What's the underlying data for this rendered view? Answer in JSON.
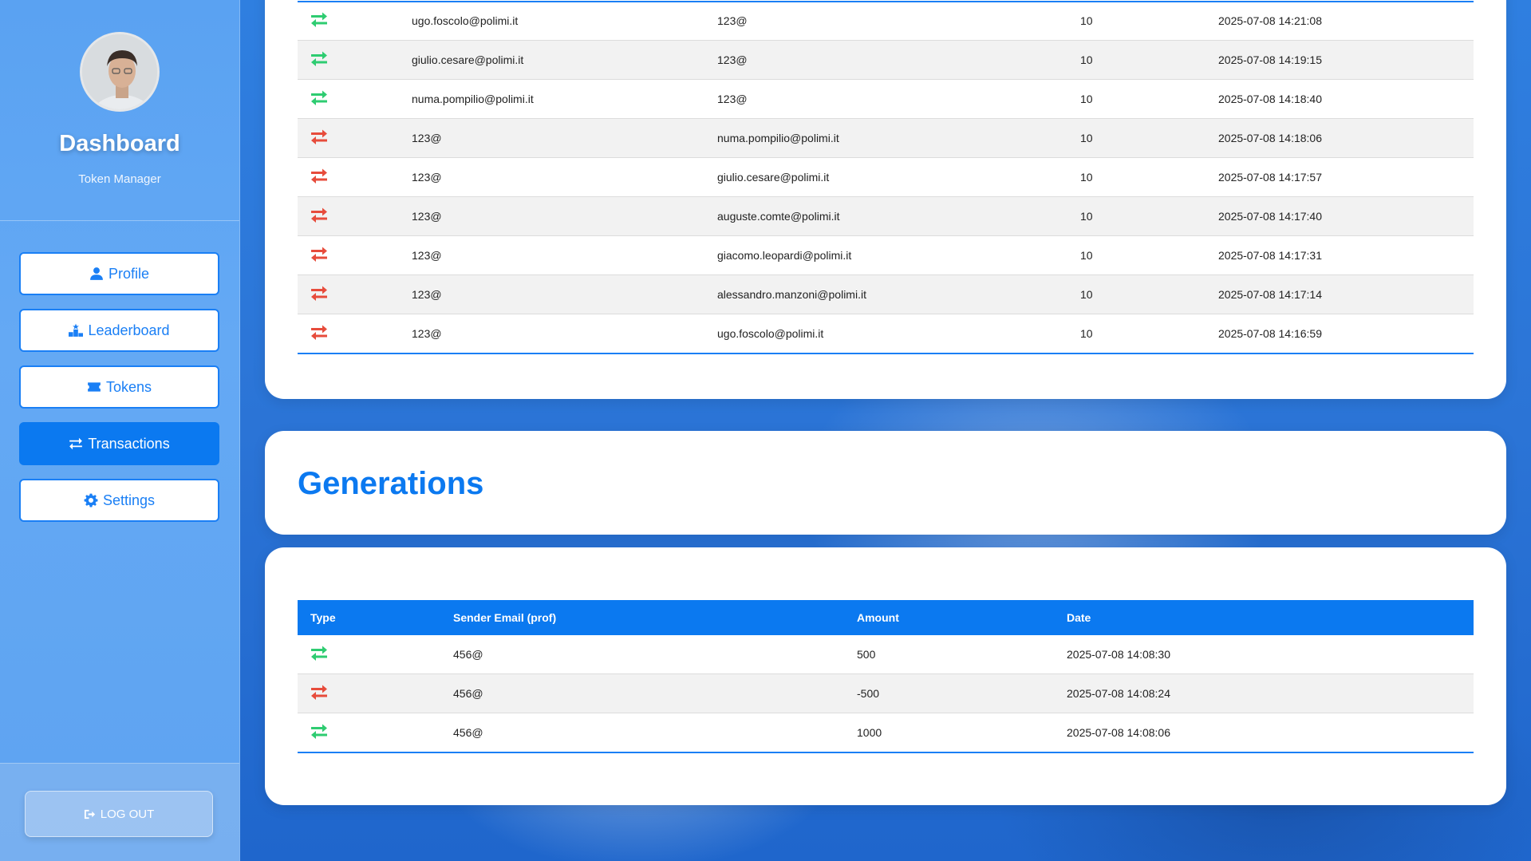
{
  "sidebar": {
    "title": "Dashboard",
    "subtitle": "Token Manager",
    "nav": [
      {
        "label": "Profile",
        "icon": "user-icon"
      },
      {
        "label": "Leaderboard",
        "icon": "podium-icon"
      },
      {
        "label": "Tokens",
        "icon": "ticket-icon"
      },
      {
        "label": "Transactions",
        "icon": "exchange-icon",
        "active": true
      },
      {
        "label": "Settings",
        "icon": "gear-icon"
      }
    ],
    "logout_label": "LOG OUT"
  },
  "transactions": {
    "rows": [
      {
        "type": "in",
        "sender": "ugo.foscolo@polimi.it",
        "receiver": "123@",
        "amount": "10",
        "date": "2025-07-08 14:21:08"
      },
      {
        "type": "in",
        "sender": "giulio.cesare@polimi.it",
        "receiver": "123@",
        "amount": "10",
        "date": "2025-07-08 14:19:15"
      },
      {
        "type": "in",
        "sender": "numa.pompilio@polimi.it",
        "receiver": "123@",
        "amount": "10",
        "date": "2025-07-08 14:18:40"
      },
      {
        "type": "out",
        "sender": "123@",
        "receiver": "numa.pompilio@polimi.it",
        "amount": "10",
        "date": "2025-07-08 14:18:06"
      },
      {
        "type": "out",
        "sender": "123@",
        "receiver": "giulio.cesare@polimi.it",
        "amount": "10",
        "date": "2025-07-08 14:17:57"
      },
      {
        "type": "out",
        "sender": "123@",
        "receiver": "auguste.comte@polimi.it",
        "amount": "10",
        "date": "2025-07-08 14:17:40"
      },
      {
        "type": "out",
        "sender": "123@",
        "receiver": "giacomo.leopardi@polimi.it",
        "amount": "10",
        "date": "2025-07-08 14:17:31"
      },
      {
        "type": "out",
        "sender": "123@",
        "receiver": "alessandro.manzoni@polimi.it",
        "amount": "10",
        "date": "2025-07-08 14:17:14"
      },
      {
        "type": "out",
        "sender": "123@",
        "receiver": "ugo.foscolo@polimi.it",
        "amount": "10",
        "date": "2025-07-08 14:16:59"
      }
    ]
  },
  "generations": {
    "title": "Generations",
    "headers": {
      "type": "Type",
      "sender": "Sender Email (prof)",
      "amount": "Amount",
      "date": "Date"
    },
    "rows": [
      {
        "type": "in",
        "sender": "456@",
        "amount": "500",
        "date": "2025-07-08 14:08:30"
      },
      {
        "type": "out",
        "sender": "456@",
        "amount": "-500",
        "date": "2025-07-08 14:08:24"
      },
      {
        "type": "in",
        "sender": "456@",
        "amount": "1000",
        "date": "2025-07-08 14:08:06"
      }
    ]
  },
  "colors": {
    "accent": "#0b79f0",
    "in": "#2ecc71",
    "out": "#e74c3c"
  }
}
